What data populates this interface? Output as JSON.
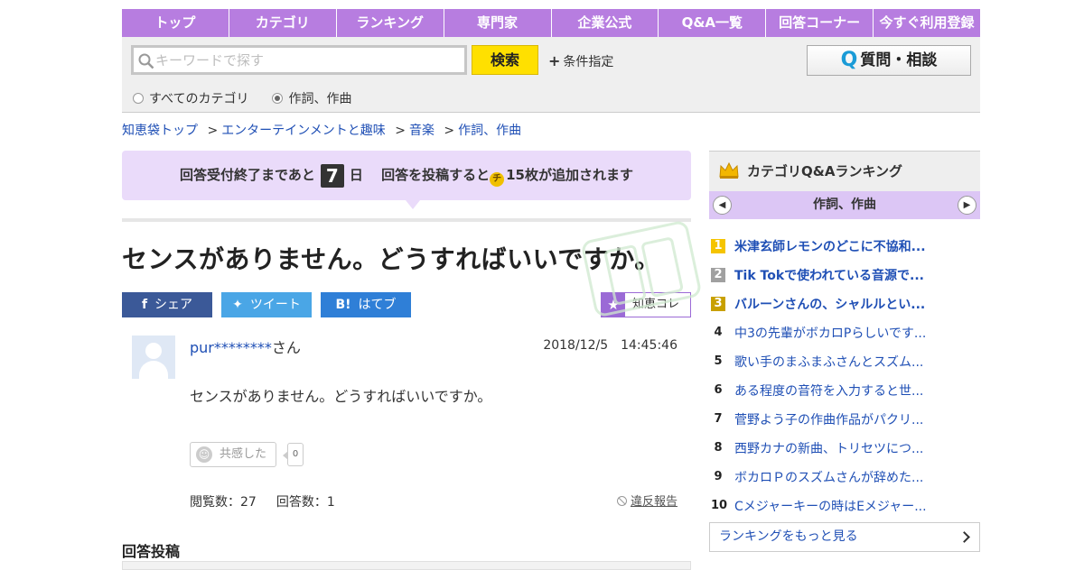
{
  "nav": {
    "items": [
      "トップ",
      "カテゴリ",
      "ランキング",
      "専門家",
      "企業公式",
      "Q&A一覧",
      "回答コーナー",
      "今すぐ利用登録"
    ]
  },
  "search": {
    "placeholder": "キーワードで探す",
    "value": "",
    "button_label": "検索",
    "condition_label": "条件指定",
    "ask_label": "質問・相談",
    "ask_q": "Q",
    "radio_all": "すべてのカテゴリ",
    "radio_current": "作詞、作曲",
    "selected_radio": "作詞、作曲"
  },
  "breadcrumb": {
    "items": [
      "知恵袋トップ",
      "エンターテインメントと趣味",
      "音楽",
      "作詞、作曲"
    ],
    "separator": ">"
  },
  "notice": {
    "prefix": "回答受付終了まであと",
    "days": "7",
    "days_unit": "日",
    "suffix_a": "回答を投稿すると",
    "coin": "チ",
    "suffix_b": "15枚が追加されます"
  },
  "question": {
    "title": "センスがありません。どうすればいいですか。",
    "share_facebook": "シェア",
    "share_twitter": "ツイート",
    "share_hatebu": "はてブ",
    "hatebu_icon_text": "B!",
    "collect_label": "知恵コレ",
    "author_id": "pur********",
    "author_suffix": "さん",
    "date": "2018/12/5　14:45:46",
    "body": "センスがありません。どうすればいいですか。",
    "empathy_label": "共感した",
    "empathy_count": "0",
    "views": "閲覧数：27",
    "answers": "回答数：1",
    "report_label": "違反報告"
  },
  "answer_section": {
    "heading": "回答投稿"
  },
  "ranking": {
    "heading": "カテゴリQ&Aランキング",
    "category": "作詞、作曲",
    "items": [
      {
        "rank": "1",
        "text": "米津玄師レモンのどこに不協和..."
      },
      {
        "rank": "2",
        "text": "Tik Tokで使われている音源で..."
      },
      {
        "rank": "3",
        "text": "バルーンさんの、シャルルとい..."
      },
      {
        "rank": "4",
        "text": "中3の先輩がボカロPらしいです..."
      },
      {
        "rank": "5",
        "text": "歌い手のまふまふさんとスズム..."
      },
      {
        "rank": "6",
        "text": "ある程度の音符を入力すると世..."
      },
      {
        "rank": "7",
        "text": "菅野よう子の作曲作品がパクリ..."
      },
      {
        "rank": "8",
        "text": "西野カナの新曲、トリセツにつ..."
      },
      {
        "rank": "9",
        "text": "ボカロＰのスズムさんが辞めた..."
      },
      {
        "rank": "10",
        "text": "Cメジャーキーの時はEメジャー..."
      }
    ],
    "more_label": "ランキングをもっと見る"
  },
  "colors": {
    "nav": "#b77de0",
    "notice": "#eadbfa",
    "search_button": "#ffe000",
    "link": "#1f4fb5",
    "facebook": "#3b5998",
    "twitter": "#4aa6e6",
    "hatebu": "#2f7fd7",
    "ranking_sub": "#dcc6f5"
  }
}
